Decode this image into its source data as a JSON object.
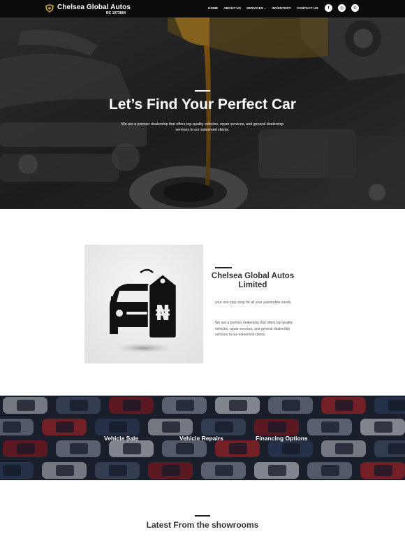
{
  "navbar": {
    "brand_name": "Chelsea Global Autos",
    "brand_rc": "RC 1973664",
    "logo_icon": "crest-icon",
    "items": [
      {
        "label": "HOME"
      },
      {
        "label": "ABOUT US"
      },
      {
        "label": "SERVICES",
        "dropdown": true
      },
      {
        "label": "INVENTORY"
      },
      {
        "label": "CONTACT US"
      }
    ],
    "socials": [
      {
        "icon": "facebook-icon",
        "glyph": "f"
      },
      {
        "icon": "instagram-icon",
        "glyph": "◎"
      },
      {
        "icon": "whatsapp-icon",
        "glyph": "✆"
      }
    ]
  },
  "hero": {
    "title": "Let’s Find Your Perfect Car",
    "subtitle": "We are a premier dealership that offers top-quality vehicles, repair services, and general dealership services to our esteemed clients."
  },
  "about": {
    "title": "Chelsea Global Autos Limited",
    "tagline": "your one-stop shop for all your automobile needs.",
    "description": "We are a premier dealership that offers top-quality vehicles, repair services, and general dealership services to our esteemed clients.",
    "price_tag_symbol": "₦"
  },
  "services": [
    {
      "label": "Vehicle Sale"
    },
    {
      "label": "Vehicle Repairs"
    },
    {
      "label": "Financing Options"
    }
  ],
  "latest": {
    "title": "Latest From the showrooms"
  },
  "colors": {
    "navbar_bg": "#0b0b0b",
    "text_dark": "#333333",
    "oil_amber": "#c8921a"
  }
}
